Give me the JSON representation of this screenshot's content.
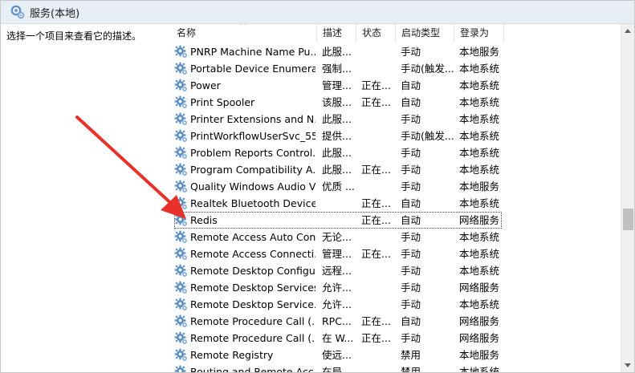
{
  "window": {
    "title": "服务(本地)"
  },
  "description_pane": {
    "text": "选择一个项目来查看它的描述。"
  },
  "list": {
    "sort_indicator": "^",
    "columns": {
      "name": "名称",
      "description": "描述",
      "status": "状态",
      "startup": "启动类型",
      "logon": "登录为"
    },
    "focused_row": 10,
    "rows": [
      {
        "name": "PNRP Machine Name Pu...",
        "description": "此服...",
        "status": "",
        "startup": "手动",
        "logon": "本地服务"
      },
      {
        "name": "Portable Device Enumera...",
        "description": "强制...",
        "status": "",
        "startup": "手动(触发...",
        "logon": "本地系统"
      },
      {
        "name": "Power",
        "description": "管理...",
        "status": "正在...",
        "startup": "自动",
        "logon": "本地系统"
      },
      {
        "name": "Print Spooler",
        "description": "该服...",
        "status": "正在...",
        "startup": "自动",
        "logon": "本地系统"
      },
      {
        "name": "Printer Extensions and N...",
        "description": "此服...",
        "status": "",
        "startup": "手动",
        "logon": "本地系统"
      },
      {
        "name": "PrintWorkflowUserSvc_55...",
        "description": "提供...",
        "status": "",
        "startup": "手动(触发...",
        "logon": "本地系统"
      },
      {
        "name": "Problem Reports Control...",
        "description": "此服...",
        "status": "",
        "startup": "手动",
        "logon": "本地系统"
      },
      {
        "name": "Program Compatibility A...",
        "description": "此服...",
        "status": "正在...",
        "startup": "手动",
        "logon": "本地系统"
      },
      {
        "name": "Quality Windows Audio V...",
        "description": "优质 ...",
        "status": "",
        "startup": "手动",
        "logon": "本地服务"
      },
      {
        "name": "Realtek Bluetooth Device...",
        "description": "",
        "status": "正在...",
        "startup": "自动",
        "logon": "本地系统"
      },
      {
        "name": "Redis",
        "description": "",
        "status": "正在...",
        "startup": "自动",
        "logon": "网络服务"
      },
      {
        "name": "Remote Access Auto Con...",
        "description": "无论...",
        "status": "",
        "startup": "手动",
        "logon": "本地系统"
      },
      {
        "name": "Remote Access Connecti...",
        "description": "管理...",
        "status": "正在...",
        "startup": "手动",
        "logon": "本地系统"
      },
      {
        "name": "Remote Desktop Configu...",
        "description": "远程...",
        "status": "",
        "startup": "手动",
        "logon": "本地系统"
      },
      {
        "name": "Remote Desktop Services",
        "description": "允许...",
        "status": "",
        "startup": "手动",
        "logon": "网络服务"
      },
      {
        "name": "Remote Desktop Service...",
        "description": "允许...",
        "status": "",
        "startup": "手动",
        "logon": "本地系统"
      },
      {
        "name": "Remote Procedure Call (...",
        "description": "RPC...",
        "status": "正在...",
        "startup": "自动",
        "logon": "网络服务"
      },
      {
        "name": "Remote Procedure Call (...",
        "description": "在 W...",
        "status": "正在...",
        "startup": "手动",
        "logon": "网络服务"
      },
      {
        "name": "Remote Registry",
        "description": "使远...",
        "status": "",
        "startup": "禁用",
        "logon": "本地服务"
      },
      {
        "name": "Routing and Remote Acc...",
        "description": "在局...",
        "status": "",
        "startup": "禁用",
        "logon": "本地系统"
      }
    ]
  },
  "colors": {
    "annotation_arrow": "#e8312a",
    "title_bar_bg": "#e8eef6",
    "gear_blue": "#5b8fc4"
  },
  "icons": {
    "title": "services-icon",
    "row": "gear-icon"
  }
}
